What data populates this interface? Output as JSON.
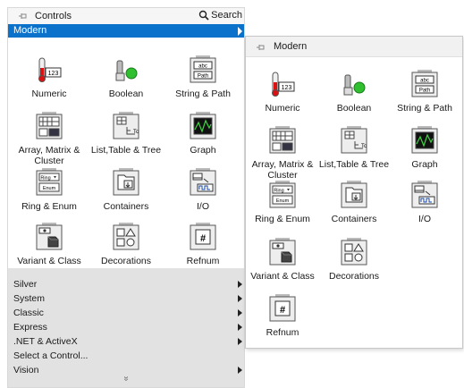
{
  "palette": {
    "title": "Controls",
    "search_label": "Search",
    "category": "Modern",
    "items": [
      {
        "label": "Numeric",
        "icon": "numeric-icon"
      },
      {
        "label": "Boolean",
        "icon": "boolean-icon"
      },
      {
        "label": "String & Path",
        "icon": "string-path-icon"
      },
      {
        "label": "Array, Matrix & Cluster",
        "icon": "array-icon"
      },
      {
        "label": "List,Table & Tree",
        "icon": "list-icon"
      },
      {
        "label": "Graph",
        "icon": "graph-icon"
      },
      {
        "label": "Ring & Enum",
        "icon": "ring-icon"
      },
      {
        "label": "Containers",
        "icon": "containers-icon"
      },
      {
        "label": "I/O",
        "icon": "io-icon"
      },
      {
        "label": "Variant & Class",
        "icon": "variant-icon"
      },
      {
        "label": "Decorations",
        "icon": "decorations-icon"
      },
      {
        "label": "Refnum",
        "icon": "refnum-icon"
      }
    ],
    "categories": [
      {
        "label": "Silver",
        "has_submenu": true
      },
      {
        "label": "System",
        "has_submenu": true
      },
      {
        "label": "Classic",
        "has_submenu": true
      },
      {
        "label": "Express",
        "has_submenu": true
      },
      {
        "label": ".NET & ActiveX",
        "has_submenu": true
      },
      {
        "label": "Select a Control...",
        "has_submenu": false
      },
      {
        "label": "Vision",
        "has_submenu": true
      }
    ],
    "more_glyph": "»"
  },
  "subpalette": {
    "title": "Modern",
    "items": [
      {
        "label": "Numeric",
        "icon": "numeric-icon"
      },
      {
        "label": "Boolean",
        "icon": "boolean-icon"
      },
      {
        "label": "String & Path",
        "icon": "string-path-icon"
      },
      {
        "label": "Array, Matrix & Cluster",
        "icon": "array-icon"
      },
      {
        "label": "List,Table & Tree",
        "icon": "list-icon"
      },
      {
        "label": "Graph",
        "icon": "graph-icon"
      },
      {
        "label": "Ring & Enum",
        "icon": "ring-icon"
      },
      {
        "label": "Containers",
        "icon": "containers-icon"
      },
      {
        "label": "I/O",
        "icon": "io-icon"
      },
      {
        "label": "Variant & Class",
        "icon": "variant-icon"
      },
      {
        "label": "Decorations",
        "icon": "decorations-icon"
      },
      {
        "label": "Refnum",
        "icon": "refnum-icon"
      }
    ]
  },
  "colors": {
    "accent": "#0b72cc",
    "led_green": "#2fbf2f",
    "list_bg": "#e2e2e2"
  }
}
